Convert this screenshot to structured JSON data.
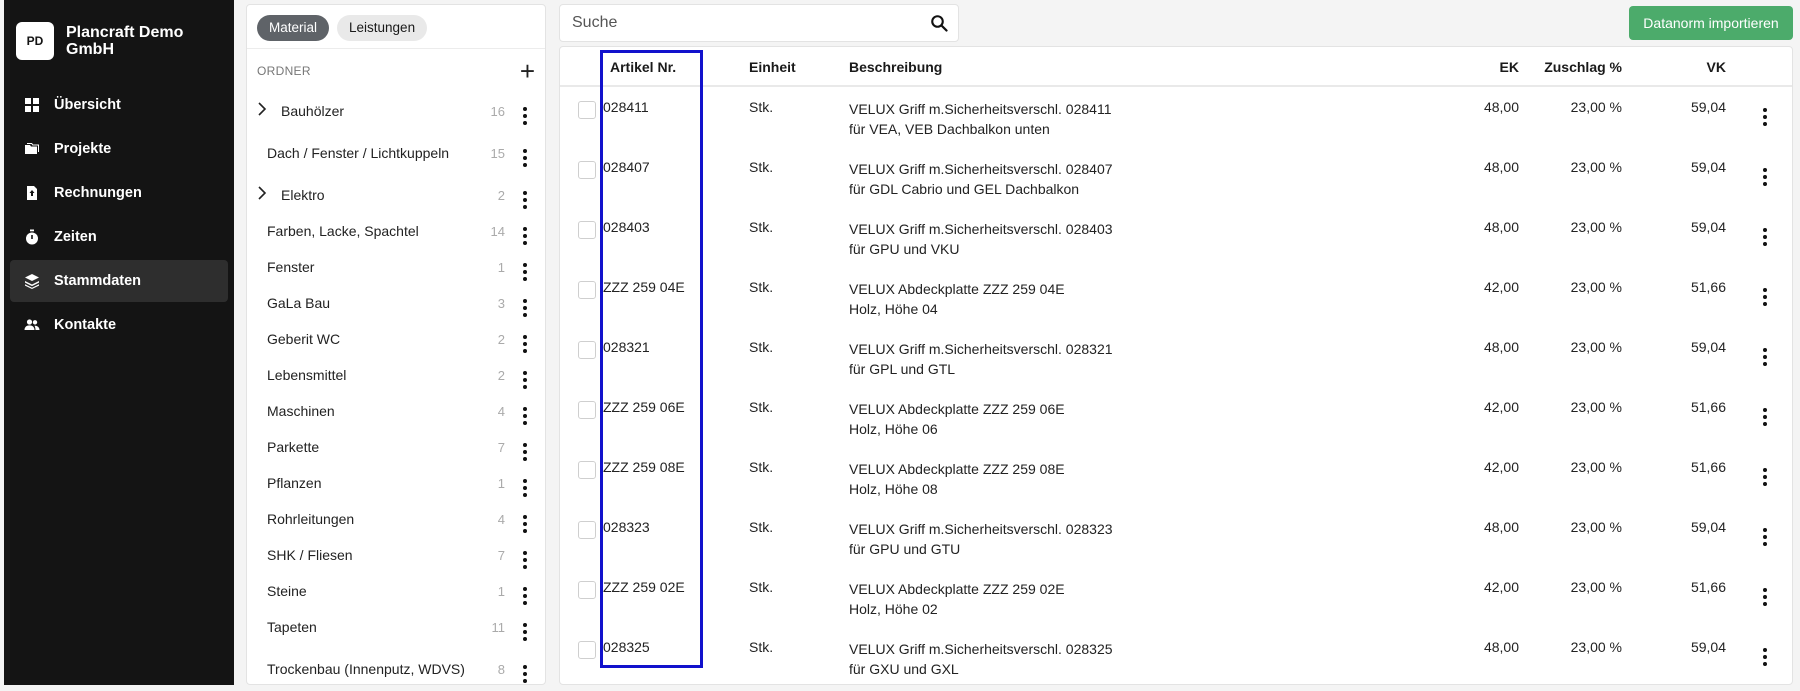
{
  "org": {
    "initials": "PD",
    "name": "Plancraft Demo GmbH"
  },
  "nav": [
    {
      "label": "Übersicht",
      "icon": "dashboard-icon",
      "active": false
    },
    {
      "label": "Projekte",
      "icon": "folders-icon",
      "active": false
    },
    {
      "label": "Rechnungen",
      "icon": "invoice-icon",
      "active": false
    },
    {
      "label": "Zeiten",
      "icon": "stopwatch-icon",
      "active": false
    },
    {
      "label": "Stammdaten",
      "icon": "layers-icon",
      "active": true
    },
    {
      "label": "Kontakte",
      "icon": "people-icon",
      "active": false
    }
  ],
  "tabs": [
    {
      "label": "Material",
      "active": true
    },
    {
      "label": "Leistungen",
      "active": false
    }
  ],
  "folder_header": "ORDNER",
  "folders": [
    {
      "name": "Bauhölzer",
      "count": "16",
      "expandable": true
    },
    {
      "name": "Dach / Fenster / Lichtkuppeln",
      "count": "15",
      "expandable": false
    },
    {
      "name": "Elektro",
      "count": "2",
      "expandable": true
    },
    {
      "name": "Farben, Lacke, Spachtel",
      "count": "14",
      "expandable": false
    },
    {
      "name": "Fenster",
      "count": "1",
      "expandable": false
    },
    {
      "name": "GaLa Bau",
      "count": "3",
      "expandable": false
    },
    {
      "name": "Geberit WC",
      "count": "2",
      "expandable": false
    },
    {
      "name": "Lebensmittel",
      "count": "2",
      "expandable": false
    },
    {
      "name": "Maschinen",
      "count": "4",
      "expandable": false
    },
    {
      "name": "Parkette",
      "count": "7",
      "expandable": false
    },
    {
      "name": "Pflanzen",
      "count": "1",
      "expandable": false
    },
    {
      "name": "Rohrleitungen",
      "count": "4",
      "expandable": false
    },
    {
      "name": "SHK / Fliesen",
      "count": "7",
      "expandable": false
    },
    {
      "name": "Steine",
      "count": "1",
      "expandable": false
    },
    {
      "name": "Tapeten",
      "count": "11",
      "expandable": false
    },
    {
      "name": "Trockenbau (Innenputz, WDVS)",
      "count": "8",
      "expandable": false
    }
  ],
  "search": {
    "placeholder": "Suche"
  },
  "import_button": "Datanorm importieren",
  "table": {
    "headers": {
      "artikel": "Artikel Nr.",
      "einheit": "Einheit",
      "beschreibung": "Beschreibung",
      "ek": "EK",
      "zuschlag": "Zuschlag %",
      "vk": "VK"
    },
    "rows": [
      {
        "artikel": "028411",
        "einheit": "Stk.",
        "desc1": "VELUX Griff m.Sicherheitsverschl. 028411",
        "desc2": "für VEA, VEB Dachbalkon unten",
        "ek": "48,00",
        "zuschlag": "23,00 %",
        "vk": "59,04"
      },
      {
        "artikel": "028407",
        "einheit": "Stk.",
        "desc1": "VELUX Griff m.Sicherheitsverschl. 028407",
        "desc2": "für GDL Cabrio und GEL Dachbalkon",
        "ek": "48,00",
        "zuschlag": "23,00 %",
        "vk": "59,04"
      },
      {
        "artikel": "028403",
        "einheit": "Stk.",
        "desc1": "VELUX Griff m.Sicherheitsverschl. 028403",
        "desc2": "für GPU und VKU",
        "ek": "48,00",
        "zuschlag": "23,00 %",
        "vk": "59,04"
      },
      {
        "artikel": "ZZZ 259 04E",
        "einheit": "Stk.",
        "desc1": "VELUX Abdeckplatte ZZZ 259 04E",
        "desc2": "Holz, Höhe 04",
        "ek": "42,00",
        "zuschlag": "23,00 %",
        "vk": "51,66"
      },
      {
        "artikel": "028321",
        "einheit": "Stk.",
        "desc1": "VELUX Griff m.Sicherheitsverschl. 028321",
        "desc2": "für GPL und GTL",
        "ek": "48,00",
        "zuschlag": "23,00 %",
        "vk": "59,04"
      },
      {
        "artikel": "ZZZ 259 06E",
        "einheit": "Stk.",
        "desc1": "VELUX Abdeckplatte ZZZ 259 06E",
        "desc2": "Holz, Höhe 06",
        "ek": "42,00",
        "zuschlag": "23,00 %",
        "vk": "51,66"
      },
      {
        "artikel": "ZZZ 259 08E",
        "einheit": "Stk.",
        "desc1": "VELUX Abdeckplatte ZZZ 259 08E",
        "desc2": "Holz, Höhe 08",
        "ek": "42,00",
        "zuschlag": "23,00 %",
        "vk": "51,66"
      },
      {
        "artikel": "028323",
        "einheit": "Stk.",
        "desc1": "VELUX Griff m.Sicherheitsverschl. 028323",
        "desc2": "für GPU und GTU",
        "ek": "48,00",
        "zuschlag": "23,00 %",
        "vk": "59,04"
      },
      {
        "artikel": "ZZZ 259 02E",
        "einheit": "Stk.",
        "desc1": "VELUX Abdeckplatte ZZZ 259 02E",
        "desc2": "Holz, Höhe 02",
        "ek": "42,00",
        "zuschlag": "23,00 %",
        "vk": "51,66"
      },
      {
        "artikel": "028325",
        "einheit": "Stk.",
        "desc1": "VELUX Griff m.Sicherheitsverschl. 028325",
        "desc2": "für GXU und GXL",
        "ek": "48,00",
        "zuschlag": "23,00 %",
        "vk": "59,04"
      }
    ]
  },
  "colors": {
    "sidebar": "#141414",
    "accent_green": "#4cab6b",
    "highlight": "#1111cc"
  }
}
